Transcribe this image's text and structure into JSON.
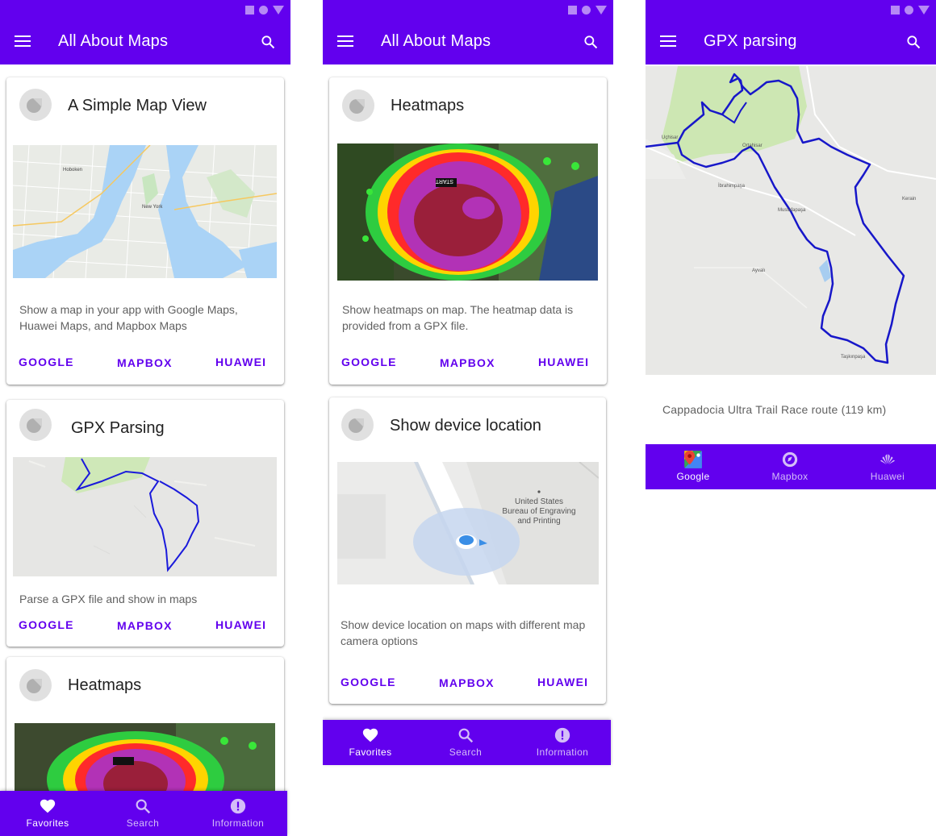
{
  "colors": {
    "primary": "#6200ee",
    "accent_text": "#6200ee",
    "card_bg": "#ffffff"
  },
  "screen1": {
    "appbar": {
      "title": "All About Maps",
      "menu_icon": "menu-icon",
      "search_icon": "search-icon"
    },
    "cards": [
      {
        "title": "A Simple Map View",
        "description": "Show a map in your app with Google Maps, Huawei Maps, and Mapbox Maps",
        "buttons": [
          "GOOGLE",
          "MAPBOX",
          "HUAWEI"
        ],
        "map_labels": {
          "l1": "Hoboken",
          "l2": "New York"
        }
      },
      {
        "title": "GPX Parsing",
        "description": "Parse a GPX file and show in maps",
        "buttons": [
          "GOOGLE",
          "MAPBOX",
          "HUAWEI"
        ]
      },
      {
        "title": "Heatmaps"
      }
    ],
    "bottom_nav": [
      {
        "label": "Favorites",
        "icon": "heart-icon",
        "active": true
      },
      {
        "label": "Search",
        "icon": "search-icon",
        "active": false
      },
      {
        "label": "Information",
        "icon": "info-icon",
        "active": false
      }
    ]
  },
  "screen2": {
    "appbar": {
      "title": "All About Maps"
    },
    "cards": [
      {
        "title": "Heatmaps",
        "description": "Show heatmaps on map. The heatmap data is provided from a GPX file.",
        "buttons": [
          "GOOGLE",
          "MAPBOX",
          "HUAWEI"
        ],
        "sign": "START"
      },
      {
        "title": "Show device location",
        "description": "Show device location on maps with different map camera options",
        "buttons": [
          "GOOGLE",
          "MAPBOX",
          "HUAWEI"
        ],
        "map_label": [
          "United States",
          "Bureau of Engraving",
          "and Printing"
        ]
      }
    ],
    "bottom_nav": [
      {
        "label": "Favorites",
        "icon": "heart-icon",
        "active": true
      },
      {
        "label": "Search",
        "icon": "search-icon",
        "active": false
      },
      {
        "label": "Information",
        "icon": "info-icon",
        "active": false
      }
    ]
  },
  "screen3": {
    "appbar": {
      "title": "GPX parsing"
    },
    "map_labels": {
      "l1": "Ortahisar",
      "l2": "Mustafapaşa",
      "l3": "İbrahimpaşa",
      "l4": "Ayvalı",
      "l5": "Taşkınpaşa",
      "l6": "Uçhisar",
      "l7": "Kerain"
    },
    "caption": "Cappadocia Ultra Trail Race route (119 km)",
    "bottom_nav": [
      {
        "label": "Google",
        "icon": "google-maps-icon",
        "active": true
      },
      {
        "label": "Mapbox",
        "icon": "mapbox-icon",
        "active": false
      },
      {
        "label": "Huawei",
        "icon": "huawei-icon",
        "active": false
      }
    ]
  }
}
